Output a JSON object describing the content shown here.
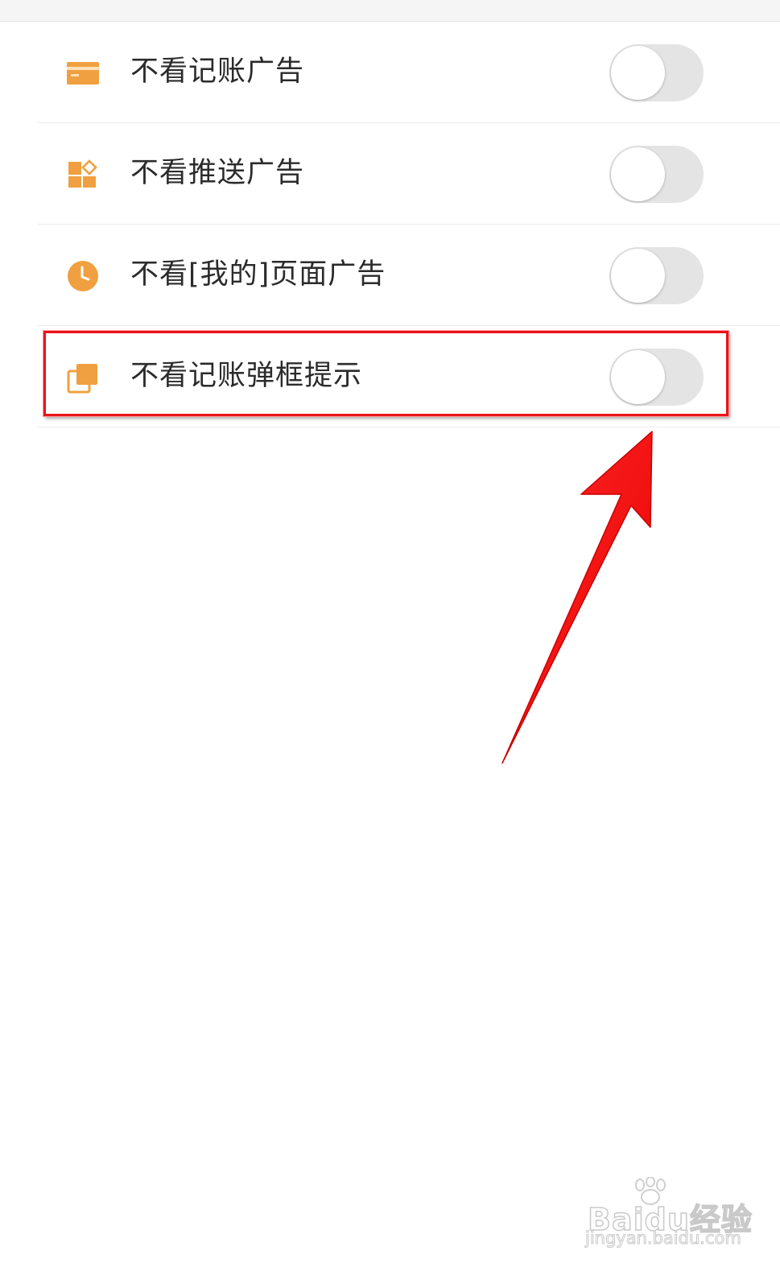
{
  "settings": {
    "items": [
      {
        "label": "不看记账广告",
        "icon": "card-icon",
        "enabled": false
      },
      {
        "label": "不看推送广告",
        "icon": "widgets-icon",
        "enabled": false
      },
      {
        "label": "不看[我的]页面广告",
        "icon": "clock-icon",
        "enabled": false
      },
      {
        "label": "不看记账弹框提示",
        "icon": "popup-layers-icon",
        "enabled": false,
        "highlighted": true
      }
    ]
  },
  "colors": {
    "icon_accent": "#f0a040",
    "toggle_off_track": "#e4e4e4",
    "annotation_red": "#ff0000"
  },
  "watermark": {
    "logo": "Baidu经验",
    "url": "jingyan.baidu.com"
  }
}
